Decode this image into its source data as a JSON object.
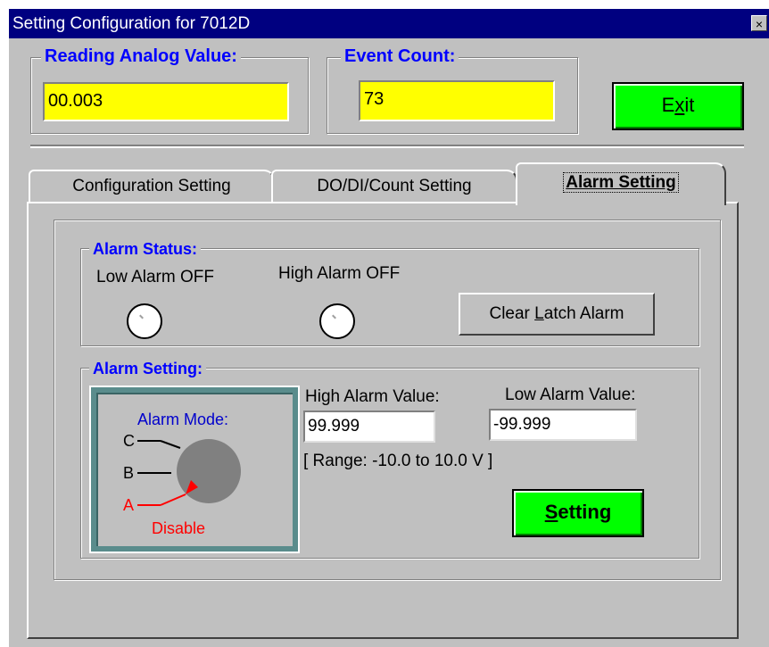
{
  "window": {
    "title": "Setting Configuration for 7012D",
    "close_glyph": "×"
  },
  "reading": {
    "label": "Reading  Analog Value:",
    "value": "00.003"
  },
  "event": {
    "label": "Event Count:",
    "value": "73"
  },
  "exit_button": {
    "pre": "E",
    "hot": "x",
    "post": "it"
  },
  "tabs": [
    {
      "label": "Configuration Setting"
    },
    {
      "label": "DO/DI/Count Setting"
    },
    {
      "label": "Alarm Setting"
    }
  ],
  "alarm_status": {
    "label": "Alarm Status:",
    "low_alarm": "Low Alarm OFF",
    "high_alarm": "High Alarm OFF",
    "clear_button": {
      "pre": "Clear ",
      "hot": "L",
      "post": "atch Alarm"
    }
  },
  "alarm_setting": {
    "label": "Alarm Setting:",
    "mode_label": "Alarm Mode:",
    "mode_c": "C",
    "mode_b": "B",
    "mode_a": "A",
    "mode_value": "Disable",
    "high_label": "High Alarm Value:",
    "high_value": "99.999",
    "low_label": "Low Alarm Value:",
    "low_value": "-99.999",
    "range_text": "[ Range: -10.0 to 10.0 V ]",
    "setting_button": {
      "hot": "S",
      "post": "etting"
    }
  },
  "colors": {
    "highlight": "#ffff00",
    "button": "#00ff00",
    "legend": "#0000ff",
    "alarm": "#ff0000"
  }
}
